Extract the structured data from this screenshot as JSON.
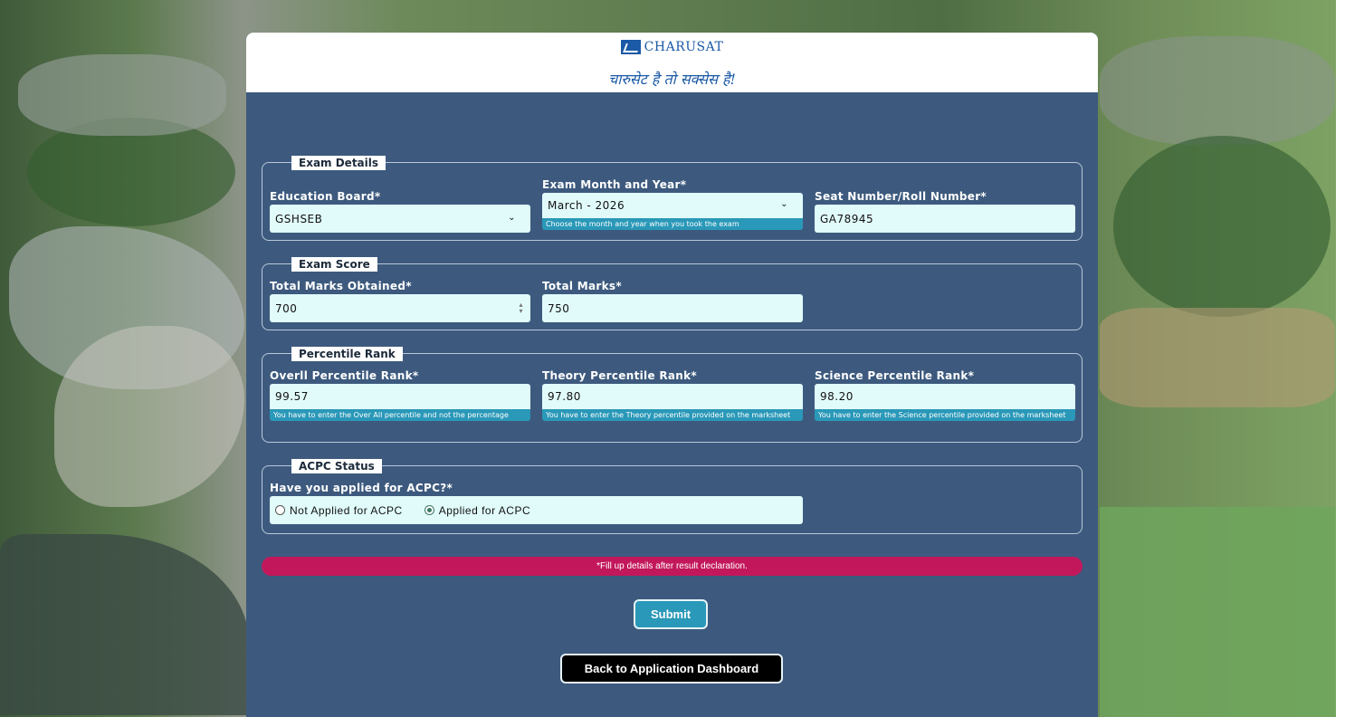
{
  "brand": {
    "logo_text": "CHARUSAT",
    "tagline": "चारुसेट है तो सक्सेस है!"
  },
  "exam_details": {
    "legend": "Exam Details",
    "education_board": {
      "label": "Education Board*",
      "value": "GSHSEB"
    },
    "exam_month_year": {
      "label": "Exam Month and Year*",
      "value": "March - 2026",
      "hint": "Choose the month and year when you took the exam"
    },
    "seat_number": {
      "label": "Seat Number/Roll Number*",
      "value": "GA78945"
    }
  },
  "exam_score": {
    "legend": "Exam Score",
    "total_obtained": {
      "label": "Total Marks Obtained*",
      "value": "700"
    },
    "total_marks": {
      "label": "Total Marks*",
      "value": "750"
    }
  },
  "percentile_rank": {
    "legend": "Percentile Rank",
    "overall": {
      "label": "Overll Percentile Rank*",
      "value": "99.57",
      "hint": "You have to enter the Over All percentile and not the percentage"
    },
    "theory": {
      "label": "Theory Percentile Rank*",
      "value": "97.80",
      "hint": "You have to enter the Theory percentile provided on the marksheet"
    },
    "science": {
      "label": "Science Percentile Rank*",
      "value": "98.20",
      "hint": "You have to enter the Science percentile provided on the marksheet"
    }
  },
  "acpc_status": {
    "legend": "ACPC Status",
    "question": "Have you applied for ACPC?*",
    "options": [
      {
        "label": "Not Applied for ACPC",
        "selected": false
      },
      {
        "label": "Applied for ACPC",
        "selected": true
      }
    ]
  },
  "notice": "*Fill up details after result declaration.",
  "buttons": {
    "submit": "Submit",
    "back": "Back to Application Dashboard"
  },
  "colors": {
    "panel_bg": "#3d5a7e",
    "input_bg": "#e1fbfb",
    "hint_bg": "#2a98b8",
    "notice_bg": "#c2185b",
    "brand_blue": "#1b5aa6"
  }
}
